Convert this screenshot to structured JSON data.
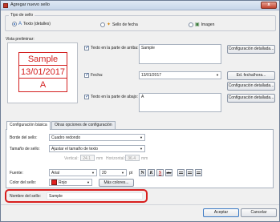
{
  "window": {
    "title": "Agregar nuevo sello",
    "close_label": "x"
  },
  "stamp_type": {
    "group_label": "Tipo de sello",
    "options": [
      {
        "label": "Texto (detalles)",
        "selected": true
      },
      {
        "label": "Sello de fecha",
        "selected": false
      },
      {
        "label": "Imagen",
        "selected": false
      }
    ]
  },
  "preview": {
    "group_label": "Vista preliminar:",
    "lines": [
      "Sample",
      "13/01/2017",
      "A"
    ],
    "color": "#d32020"
  },
  "text_top": {
    "label": "Texto en la parte de arriba:",
    "value": "Sample",
    "checked": true,
    "button": "Configuración detallada..."
  },
  "date": {
    "label": "Fecha:",
    "value": "13/01/2017",
    "checked": true,
    "button_edit": "Ed. fecha/hora...",
    "button_detail": "Configuración detallada..."
  },
  "text_bottom": {
    "label": "Texto en la parte de abajo:",
    "value": "A",
    "checked": true,
    "button": "Configuración detallada..."
  },
  "tabs": [
    {
      "label": "Configuración básica",
      "active": true
    },
    {
      "label": "Otras opciones de configuración",
      "active": false
    }
  ],
  "basic": {
    "border_label": "Borde del sello:",
    "border_value": "Cuadro redondo",
    "size_label": "Tamaño de sello:",
    "size_value": "Ajustar el tamaño de texto",
    "vertical_label": "Vertical:",
    "vertical_value": "24.1",
    "horizontal_label": "Horizontal:",
    "horizontal_value": "36.4",
    "unit": "mm",
    "font_label": "Fuente:",
    "font_value": "Arial",
    "font_size": "20",
    "font_unit": "pt",
    "style_buttons": [
      "N",
      "K",
      "S",
      "abc"
    ],
    "color_label": "Color del sello:",
    "color_value": "Rojo",
    "more_colors": "Más colores..."
  },
  "name": {
    "label": "Nombre del sello:",
    "value": "Sample"
  },
  "footer": {
    "accept": "Aceptar",
    "cancel": "Cancelar"
  },
  "accent": "#d81e1e"
}
